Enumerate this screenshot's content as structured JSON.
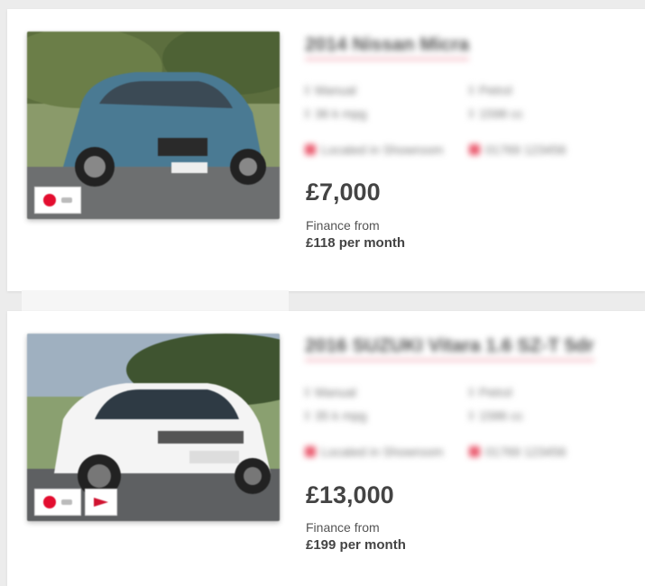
{
  "listings": [
    {
      "title": "2014 Nissan Micra",
      "specs": [
        "Manual",
        "Petrol",
        "36 k mpg",
        "1598 cc"
      ],
      "location": "Located in Showroom",
      "phone": "01769 123456",
      "price": "£7,000",
      "finance_label": "Finance from",
      "finance_value": "£118 per month",
      "car_color": "#4a7a93"
    },
    {
      "title": "2016 SUZUKI Vitara 1.6 SZ-T 5dr",
      "specs": [
        "Manual",
        "Petrol",
        "35 k mpg",
        "1586 cc"
      ],
      "location": "Located in Showroom",
      "phone": "01769 123456",
      "price": "£13,000",
      "finance_label": "Finance from",
      "finance_value": "£199 per month",
      "car_color": "#f4f4f4"
    }
  ]
}
